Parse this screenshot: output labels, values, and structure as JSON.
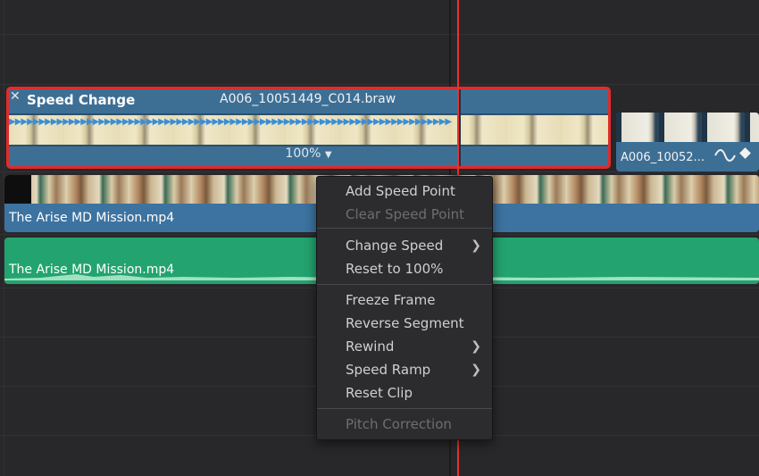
{
  "speed_clip": {
    "title": "Speed Change",
    "filename": "A006_10051449_C014.braw",
    "speed": "100%",
    "close_glyph": "✕",
    "arrows": "▶▶▶▶▶▶▶▶▶▶▶▶▶▶▶▶▶▶▶▶▶▶▶▶▶▶▶▶▶▶▶▶▶▶▶▶▶▶▶▶▶▶▶▶▶▶▶▶▶▶▶▶▶▶▶▶▶▶▶▶▶▶▶▶▶▶▶▶▶▶▶▶▶▶"
  },
  "next_clip": {
    "name": "A006_10052..."
  },
  "video_track": {
    "clip_name": "The Arise MD Mission.mp4"
  },
  "audio_track": {
    "clip_name": "The Arise MD Mission.mp4"
  },
  "context_menu": {
    "items": [
      {
        "label": "Add Speed Point",
        "enabled": true,
        "submenu": false
      },
      {
        "label": "Clear Speed Point",
        "enabled": false,
        "submenu": false
      },
      {
        "label": "Change Speed",
        "enabled": true,
        "submenu": true
      },
      {
        "label": "Reset to 100%",
        "enabled": true,
        "submenu": false
      },
      {
        "label": "Freeze Frame",
        "enabled": true,
        "submenu": false
      },
      {
        "label": "Reverse Segment",
        "enabled": true,
        "submenu": false
      },
      {
        "label": "Rewind",
        "enabled": true,
        "submenu": true
      },
      {
        "label": "Speed Ramp",
        "enabled": true,
        "submenu": true
      },
      {
        "label": "Reset Clip",
        "enabled": true,
        "submenu": false
      },
      {
        "label": "Pitch Correction",
        "enabled": false,
        "submenu": false
      }
    ]
  },
  "colors": {
    "selection_border": "#e02b2b",
    "video_clip": "#3d73a0",
    "audio_clip": "#23a36f",
    "playhead": "#e8332f"
  },
  "icons": {
    "close": "close-icon",
    "dropdown": "chevron-down-icon",
    "curve": "speed-curve-icon",
    "keyframe": "keyframe-icon",
    "submenu": "chevron-right-icon"
  }
}
